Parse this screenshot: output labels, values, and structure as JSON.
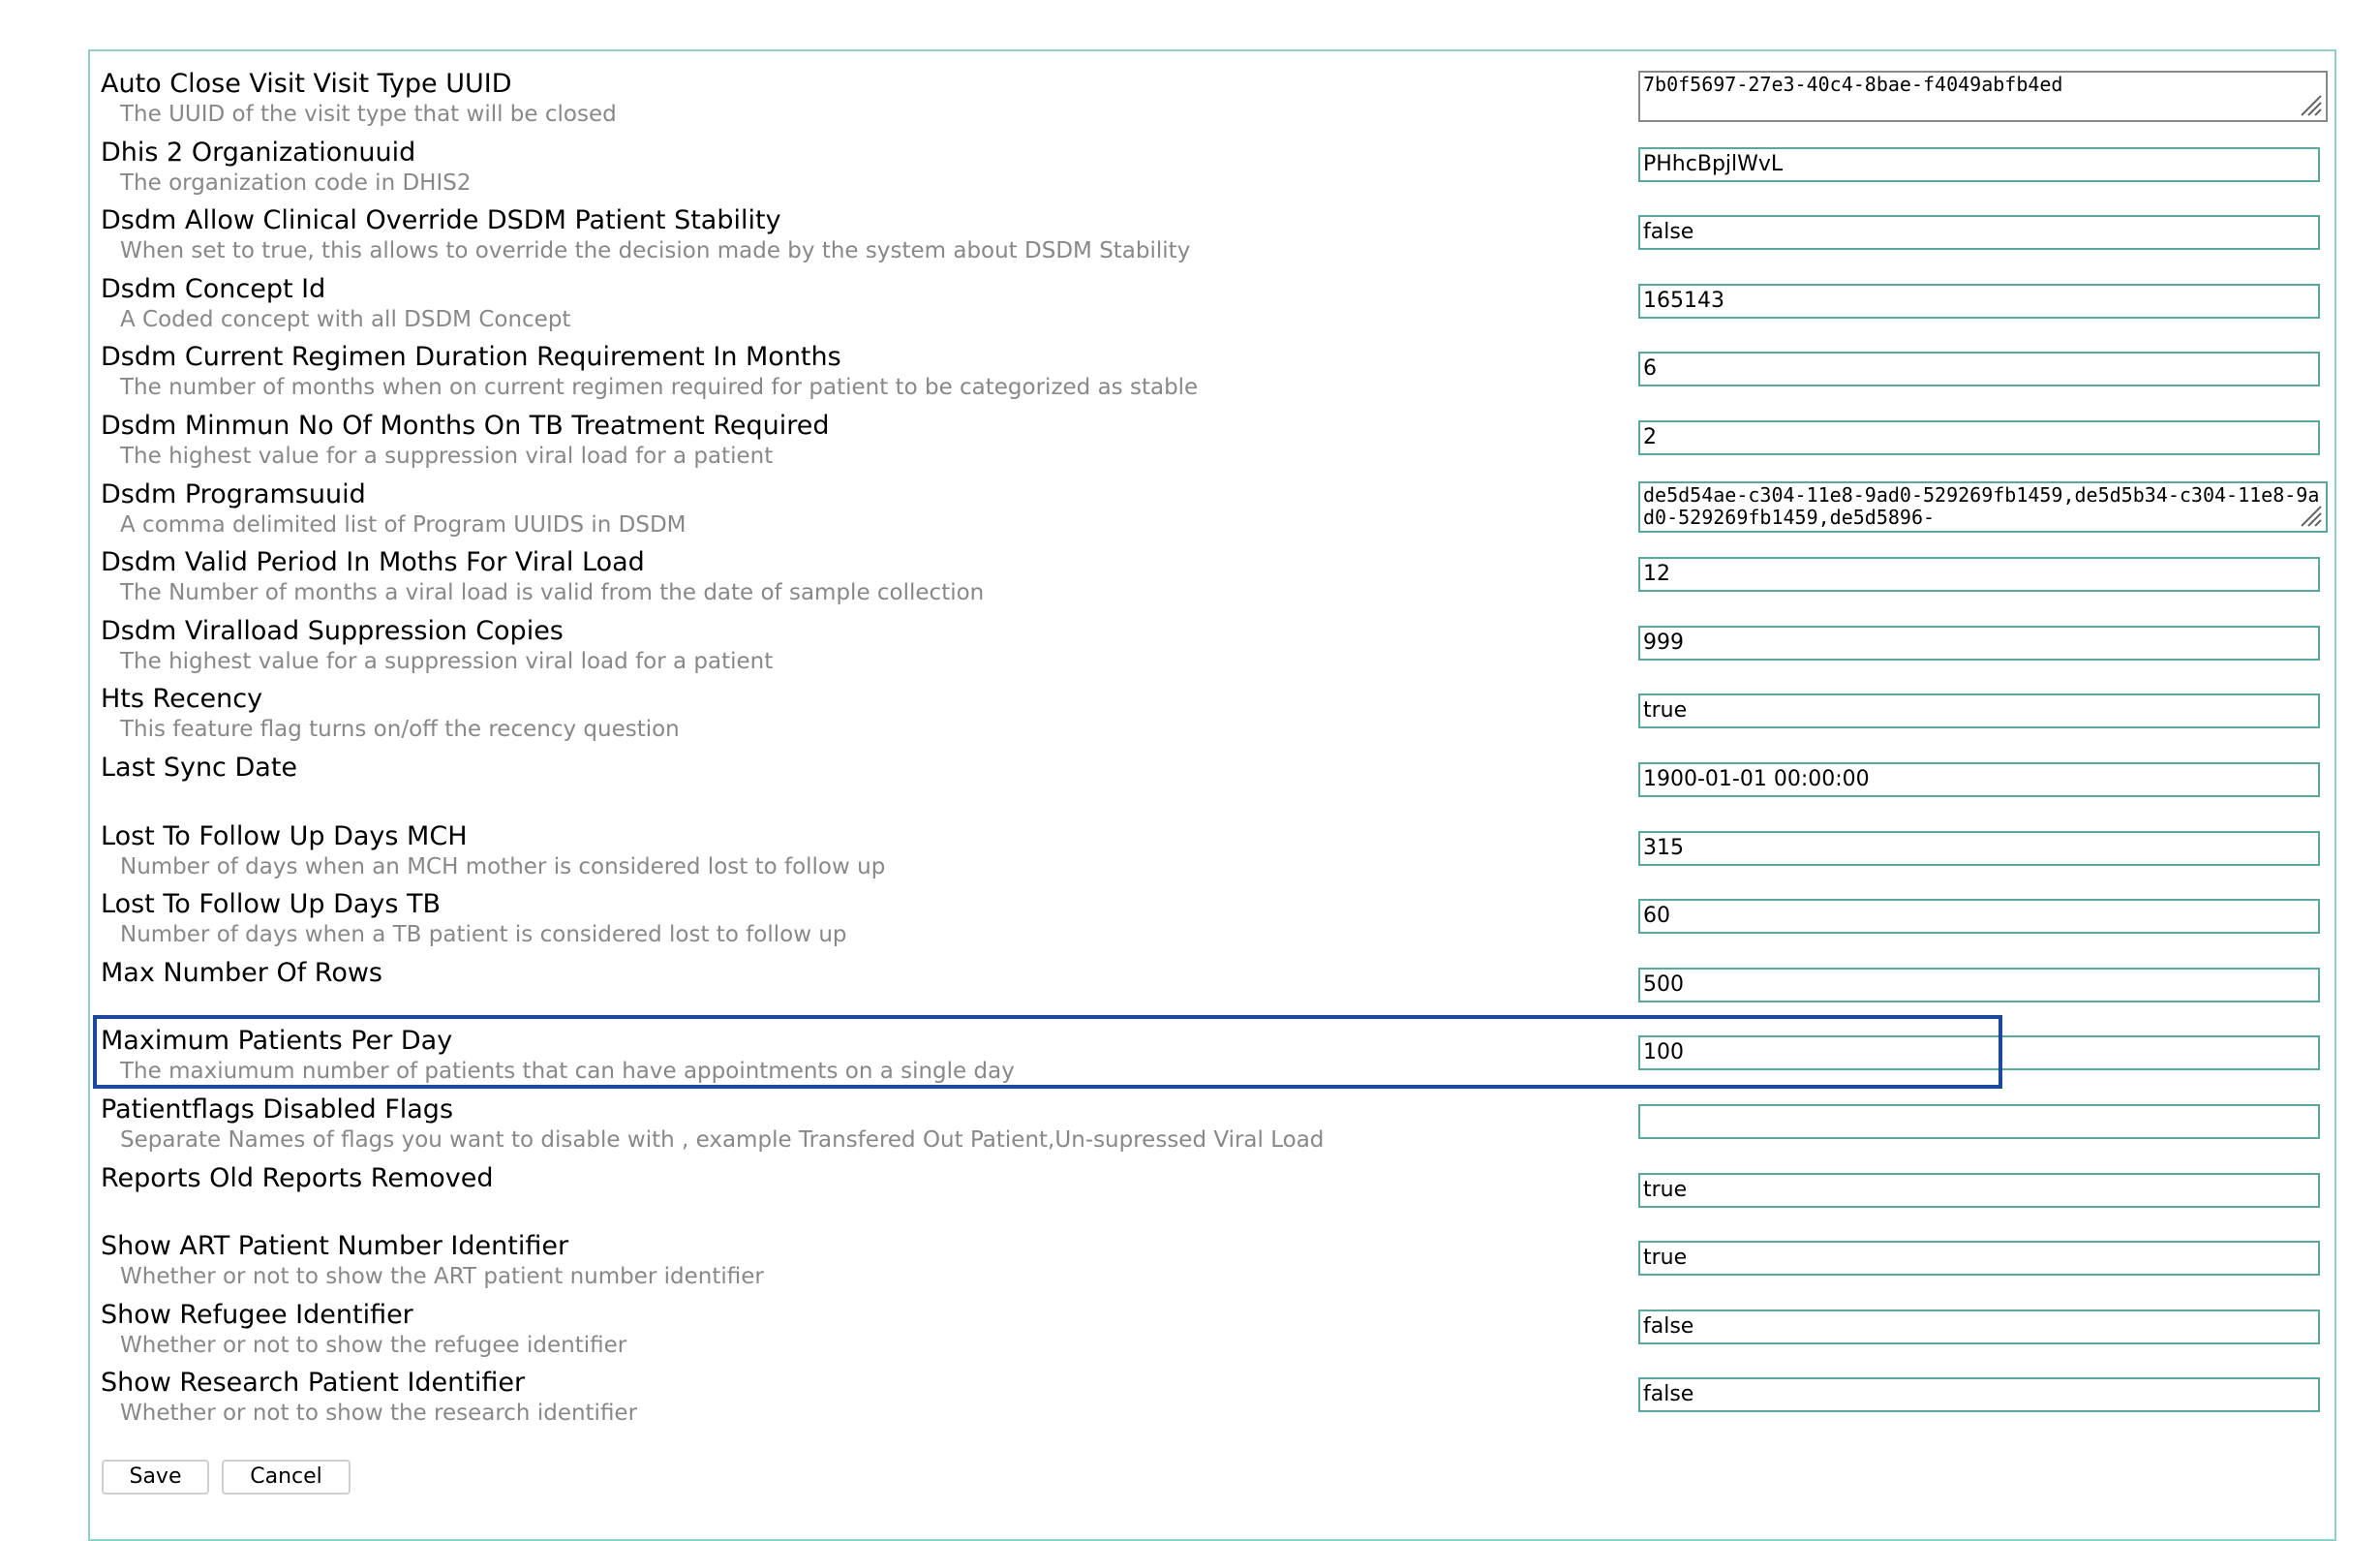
{
  "settings": [
    {
      "name": "Auto Close Visit Visit Type UUID",
      "description": "The UUID of the visit type that will be closed",
      "value": "7b0f5697-27e3-40c4-8bae-f4049abfb4ed",
      "input_type": "textarea"
    },
    {
      "name": "Dhis 2 Organizationuuid",
      "description": "The organization code in DHIS2",
      "value": "PHhcBpjlWvL",
      "input_type": "text"
    },
    {
      "name": "Dsdm Allow Clinical Override DSDM Patient Stability",
      "description": "When set to true, this allows to override the decision made by the system about DSDM Stability",
      "value": "false",
      "input_type": "text"
    },
    {
      "name": "Dsdm Concept Id",
      "description": "A Coded concept with all DSDM Concept",
      "value": "165143",
      "input_type": "text"
    },
    {
      "name": "Dsdm Current Regimen Duration Requirement In Months",
      "description": "The number of months when on current regimen required for patient to be categorized as stable",
      "value": "6",
      "input_type": "text"
    },
    {
      "name": "Dsdm Minmun No Of Months On TB Treatment Required",
      "description": "The highest value for a suppression viral load for a patient",
      "value": "2",
      "input_type": "text"
    },
    {
      "name": "Dsdm Programsuuid",
      "description": "A comma delimited list of Program UUIDS in DSDM",
      "value": "de5d54ae-c304-11e8-9ad0-529269fb1459,de5d5b34-c304-11e8-9ad0-529269fb1459,de5d5896-",
      "input_type": "textarea"
    },
    {
      "name": "Dsdm Valid Period In Moths For Viral Load",
      "description": "The Number of months a viral load is valid from the date of sample collection",
      "value": "12",
      "input_type": "text"
    },
    {
      "name": "Dsdm Viralload Suppression Copies",
      "description": "The highest value for a suppression viral load for a patient",
      "value": "999",
      "input_type": "text"
    },
    {
      "name": "Hts Recency",
      "description": "This feature flag turns on/off the recency question",
      "value": "true",
      "input_type": "text"
    },
    {
      "name": "Last Sync Date",
      "description": "",
      "value": "1900-01-01 00:00:00",
      "input_type": "text"
    },
    {
      "name": "Lost To Follow Up Days MCH",
      "description": "Number of days when an MCH mother is considered lost to follow up",
      "value": "315",
      "input_type": "text"
    },
    {
      "name": "Lost To Follow Up Days TB",
      "description": "Number of days when a TB patient is considered lost to follow up",
      "value": "60",
      "input_type": "text"
    },
    {
      "name": "Max Number Of Rows",
      "description": "",
      "value": "500",
      "input_type": "text"
    },
    {
      "name": "Maximum Patients Per Day",
      "description": "The maxiumum number of patients that can have appointments on a single day",
      "value": "100",
      "input_type": "text"
    },
    {
      "name": "Patientflags Disabled Flags",
      "description": "Separate Names of flags you want to disable with , example Transfered Out Patient,Un-supressed Viral Load",
      "value": "",
      "input_type": "text"
    },
    {
      "name": "Reports Old Reports Removed",
      "description": "",
      "value": "true",
      "input_type": "text"
    },
    {
      "name": "Show ART Patient Number Identifier",
      "description": "Whether or not to show the ART patient number identifier",
      "value": "true",
      "input_type": "text"
    },
    {
      "name": "Show Refugee Identifier",
      "description": "Whether or not to show the refugee identifier",
      "value": "false",
      "input_type": "text"
    },
    {
      "name": "Show Research Patient Identifier",
      "description": "Whether or not to show the research identifier",
      "value": "false",
      "input_type": "text"
    }
  ],
  "actions": {
    "save_label": "Save",
    "cancel_label": "Cancel"
  },
  "colors": {
    "panel_border": "#8fd0c8",
    "field_border": "#5aa7a0",
    "description_text": "#888888",
    "highlight": "#1a4a9e"
  }
}
